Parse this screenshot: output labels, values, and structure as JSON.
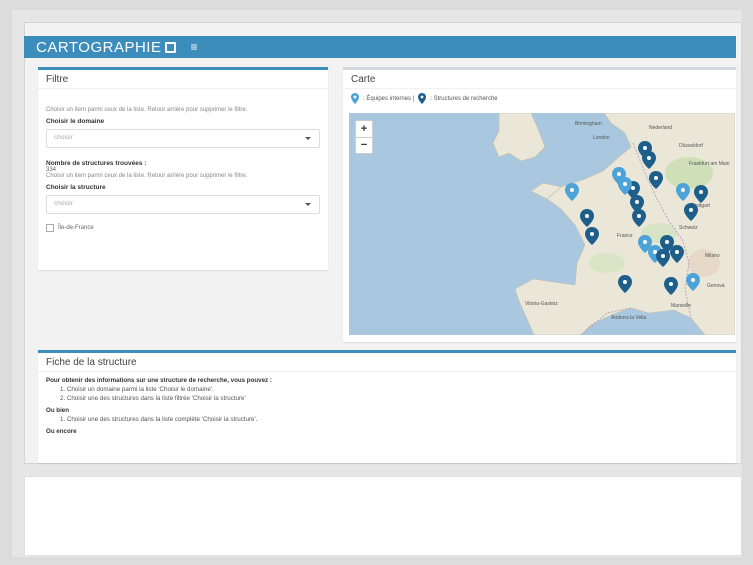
{
  "app": {
    "brand": "CARTOGRAPHIE"
  },
  "filter": {
    "title": "Filtre",
    "hint1": "Choisir un item parmi ceux de la liste. Retour arrière pour supprimer le filtre.",
    "domain_label": "Choisir le domaine",
    "domain_placeholder": "choisir",
    "count_label": "Nombre de structures trouvées :",
    "count_value": "334",
    "hint2": "Choisir un item parmi ceux de la liste. Retour arrière pour supprimer le filtre.",
    "structure_label": "Choisir la structure",
    "structure_placeholder": "choisir",
    "region_checkbox": "Île-de-France"
  },
  "map": {
    "title": "Carte",
    "legend_internal": ": Équipes internes |",
    "legend_research": ": Structures de recherche",
    "zoom_in": "+",
    "zoom_out": "−",
    "labels": [
      "Birmingham",
      "London",
      "Nederland",
      "Düsseldorf",
      "Frankfurt am Main",
      "Stuttgart",
      "Schweiz",
      "Milano",
      "Genova",
      "Marseille",
      "Vitoria-Gasteiz",
      "Andorra la Vella",
      "France"
    ]
  },
  "fiche": {
    "title": "Fiche de la structure",
    "intro": "Pour obtenir des informations sur une structure de recherche, vous pouvez :",
    "step1": "1. Choisir un domaine parmi la liste 'Choisir le domaine'.",
    "step2": "2. Choisir une des structures dans la liste filtrée 'Choisir la structure'",
    "or1": "Ou bien",
    "step3": "1. Choisir une des structures dans la liste complète 'Choisir la structure'.",
    "or2": "Ou encore"
  },
  "colors": {
    "brand": "#3c8dbc",
    "marker_internal": "#4ba3d9",
    "marker_research": "#1d5f8a"
  }
}
